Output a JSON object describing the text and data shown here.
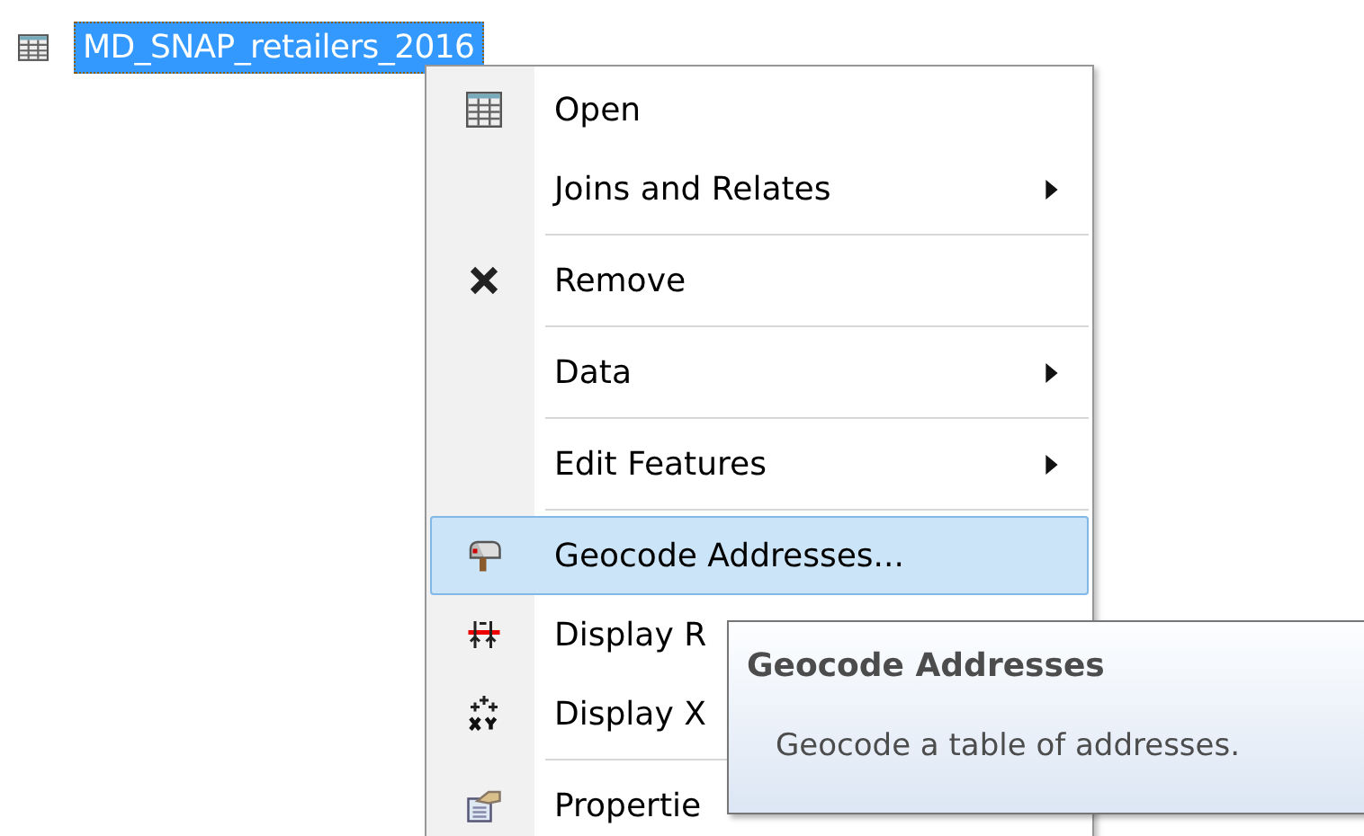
{
  "layer": {
    "name": "MD_SNAP_retailers_2016",
    "selected": true
  },
  "context_menu": {
    "items": [
      {
        "kind": "item",
        "label": "Open",
        "submenu": false,
        "selected": false
      },
      {
        "kind": "item",
        "label": "Joins and Relates",
        "submenu": true,
        "selected": false
      },
      {
        "kind": "separator"
      },
      {
        "kind": "item",
        "label": "Remove",
        "submenu": false,
        "selected": false
      },
      {
        "kind": "separator"
      },
      {
        "kind": "item",
        "label": "Data",
        "submenu": true,
        "selected": false
      },
      {
        "kind": "separator"
      },
      {
        "kind": "item",
        "label": "Edit Features",
        "submenu": true,
        "selected": false
      },
      {
        "kind": "separator"
      },
      {
        "kind": "item",
        "label": "Geocode Addresses...",
        "submenu": false,
        "selected": true
      },
      {
        "kind": "item",
        "label": "Display R",
        "selected": false
      },
      {
        "kind": "item",
        "label": "Display X",
        "selected": false
      },
      {
        "kind": "separator"
      },
      {
        "kind": "item",
        "label": "Propertie",
        "selected": false
      }
    ]
  },
  "tooltip": {
    "title": "Geocode Addresses",
    "text": "Geocode a table of addresses."
  }
}
